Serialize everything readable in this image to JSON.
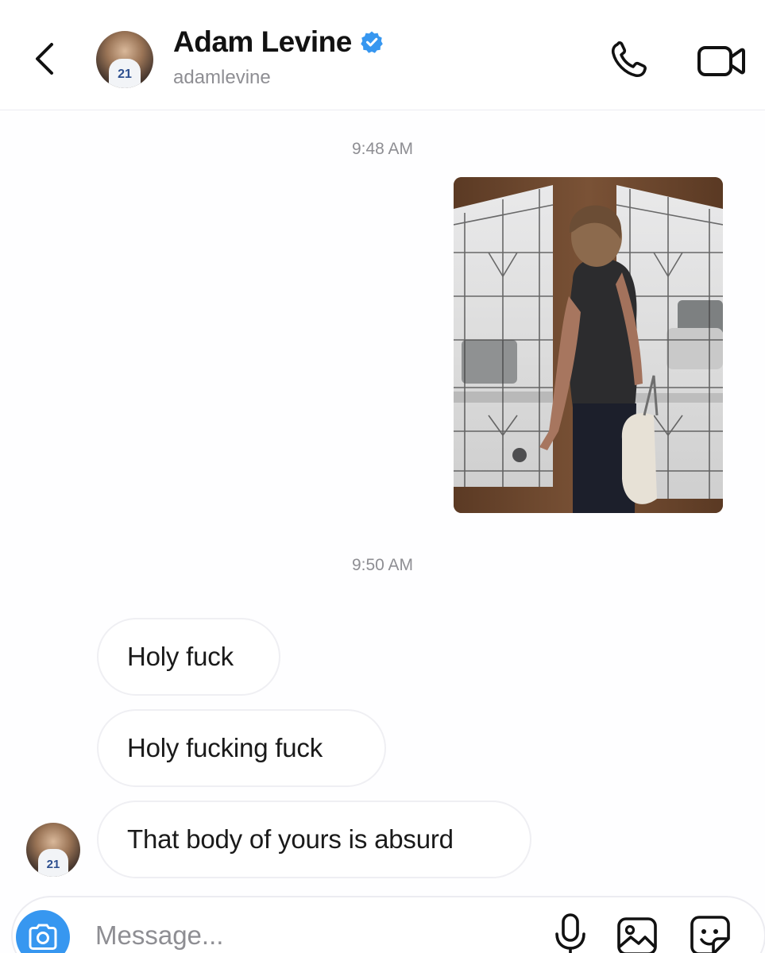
{
  "header": {
    "contact_name": "Adam Levine",
    "username": "adamlevine",
    "verified": true,
    "avatar_jersey_number": "21"
  },
  "thread": {
    "timestamps": [
      "9:48 AM",
      "9:50 AM"
    ],
    "incoming_messages": [
      "Holy fuck",
      "Holy fucking fuck",
      "That body of yours is absurd"
    ]
  },
  "composer": {
    "placeholder": "Message..."
  },
  "colors": {
    "accent_blue": "#3797f0",
    "secondary_text": "#8e8e93",
    "bubble_border": "#efeff3"
  },
  "icons": {
    "back": "chevron-left-icon",
    "verified": "verified-badge-icon",
    "call": "phone-icon",
    "video": "video-camera-icon",
    "camera": "camera-icon",
    "mic": "microphone-icon",
    "gallery": "image-icon",
    "sticker": "sticker-icon"
  }
}
